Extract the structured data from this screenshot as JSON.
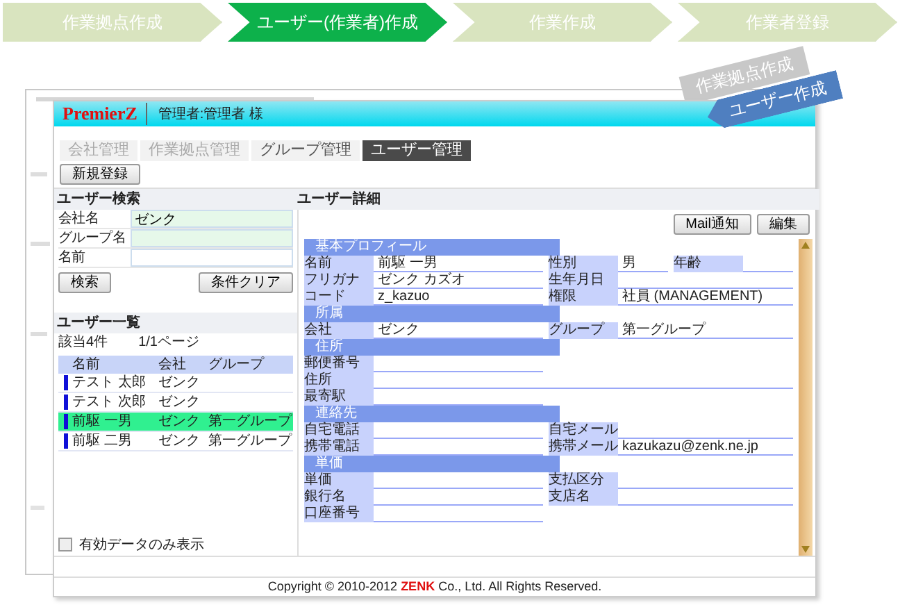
{
  "steps": [
    {
      "label": "作業拠点作成",
      "selected": false
    },
    {
      "label": "ユーザー(作業者)作成",
      "selected": true
    },
    {
      "label": "作業作成",
      "selected": false
    },
    {
      "label": "作業者登録",
      "selected": false
    }
  ],
  "callouts": [
    {
      "label": "作業拠点作成",
      "kind": "previous"
    },
    {
      "label": "ユーザー作成",
      "kind": "current"
    }
  ],
  "app": {
    "logo": "PremierZ",
    "user": "管理者:管理者 様",
    "tabs": [
      {
        "label": "会社管理",
        "selected": false,
        "disabled": true
      },
      {
        "label": "作業拠点管理",
        "selected": false,
        "disabled": true
      },
      {
        "label": "グループ管理",
        "selected": false,
        "disabled": false
      },
      {
        "label": "ユーザー管理",
        "selected": true,
        "disabled": false
      }
    ],
    "new_button": "新規登録",
    "search": {
      "title": "ユーザー検索",
      "fields": [
        {
          "label": "会社名",
          "value": "ゼンク",
          "highlighted": true
        },
        {
          "label": "グループ名",
          "highlighted": true
        },
        {
          "label": "名前",
          "highlighted": false
        }
      ],
      "buttons": [
        "検索",
        "条件クリア"
      ]
    },
    "list": {
      "title": "ユーザー一覧",
      "count": "該当4件",
      "page": "1/1ページ",
      "columns": [
        "名前",
        "会社",
        "グループ"
      ],
      "rows": [
        {
          "name": "テスト 太郎",
          "company": "ゼンク",
          "selected": false
        },
        {
          "name": "テスト 次郎",
          "company": "ゼンク",
          "selected": false
        },
        {
          "name": "前駆 一男",
          "company": "ゼンク",
          "group": "第一グループ",
          "selected": true
        },
        {
          "name": "前駆 二男",
          "company": "ゼンク",
          "group": "第一グループ",
          "selected": false
        }
      ]
    },
    "filter": {
      "label": "有効データのみ表示",
      "checked": false
    },
    "detail": {
      "title": "ユーザー詳細",
      "buttons": [
        "Mail通知",
        "編集"
      ],
      "sections": [
        {
          "title": "基本プロフィール",
          "rows": [
            [
              {
                "label": "名前",
                "value": "前駆 一男"
              },
              {
                "label": "性別",
                "value": "男"
              },
              {
                "label": "年齢"
              }
            ],
            [
              {
                "label": "フリガナ",
                "value": "ゼンク カズオ"
              },
              {
                "label": "生年月日"
              }
            ],
            [
              {
                "label": "コード",
                "value": "z_kazuo"
              },
              {
                "label": "権限",
                "value": "社員 (MANAGEMENT)"
              }
            ]
          ]
        },
        {
          "title": "所属",
          "rows": [
            [
              {
                "label": "会社",
                "value": "ゼンク"
              },
              {
                "label": "グループ",
                "value": "第一グループ"
              }
            ]
          ]
        },
        {
          "title": "住所",
          "rows": [
            [
              {
                "label": "郵便番号"
              }
            ],
            [
              {
                "label": "住所",
                "wide": true
              }
            ],
            [
              {
                "label": "最寄駅"
              }
            ]
          ]
        },
        {
          "title": "連絡先",
          "rows": [
            [
              {
                "label": "自宅電話"
              },
              {
                "label": "自宅メール"
              }
            ],
            [
              {
                "label": "携帯電話"
              },
              {
                "label": "携帯メール",
                "value": "kazukazu@zenk.ne.jp"
              }
            ]
          ]
        },
        {
          "title": "単価",
          "rows": [
            [
              {
                "label": "単価"
              },
              {
                "label": "支払区分"
              }
            ],
            [
              {
                "label": "銀行名"
              },
              {
                "label": "支店名"
              }
            ],
            [
              {
                "label": "口座番号"
              }
            ]
          ]
        }
      ]
    },
    "footer": "Copyright © 2010-2012 **ZENK** Co., Ltd. All Rights Reserved."
  }
}
